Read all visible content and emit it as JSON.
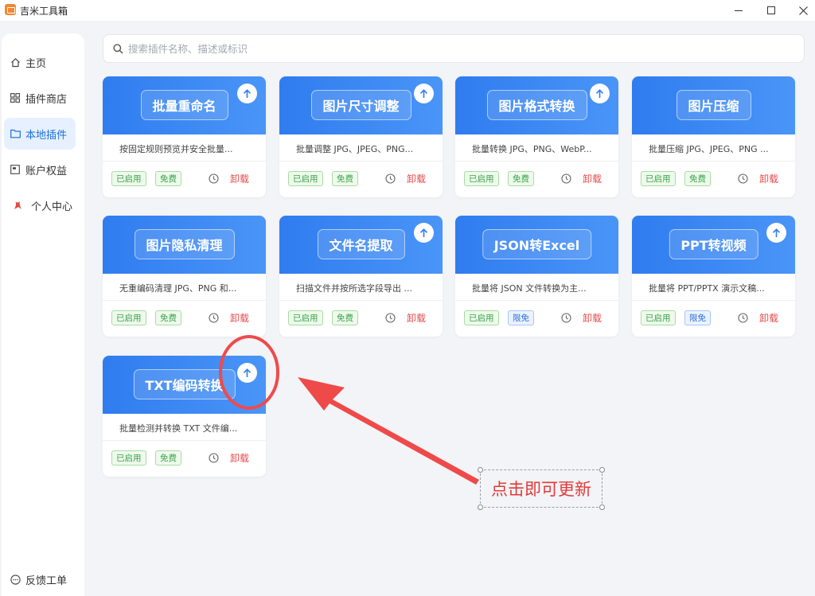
{
  "window": {
    "title": "吉米工具箱"
  },
  "sidebar": {
    "items": [
      {
        "label": "主页",
        "icon": "home-icon"
      },
      {
        "label": "插件商店",
        "icon": "grid-icon"
      },
      {
        "label": "本地插件",
        "icon": "folder-icon",
        "active": true
      },
      {
        "label": "账户权益",
        "icon": "account-icon"
      },
      {
        "label": "个人中心",
        "icon": "user-icon"
      }
    ],
    "feedback": {
      "label": "反馈工单",
      "icon": "chat-icon"
    }
  },
  "search": {
    "placeholder": "搜索插件名称、描述或标识",
    "value": ""
  },
  "cards": [
    {
      "title": "批量重命名",
      "desc": "按固定规则预览并安全批量...",
      "status": "已启用",
      "price": "免费",
      "action": "卸载",
      "update": true
    },
    {
      "title": "图片尺寸调整",
      "desc": "批量调整 JPG、JPEG、PNG...",
      "status": "已启用",
      "price": "免费",
      "action": "卸载",
      "update": true
    },
    {
      "title": "图片格式转换",
      "desc": "批量转换 JPG、PNG、WebP...",
      "status": "已启用",
      "price": "免费",
      "action": "卸载",
      "update": true
    },
    {
      "title": "图片压缩",
      "desc": "批量压缩 JPG、JPEG、PNG ...",
      "status": "已启用",
      "price": "免费",
      "action": "卸载",
      "update": false
    },
    {
      "title": "图片隐私清理",
      "desc": "无重编码清理 JPG、PNG 和...",
      "status": "已启用",
      "price": "免费",
      "action": "卸载",
      "update": false
    },
    {
      "title": "文件名提取",
      "desc": "扫描文件并按所选字段导出 ...",
      "status": "已启用",
      "price": "免费",
      "action": "卸载",
      "update": true
    },
    {
      "title": "JSON转Excel",
      "desc": "批量将 JSON 文件转换为主...",
      "status": "已启用",
      "price": "限免",
      "action": "卸载",
      "update": false
    },
    {
      "title": "PPT转视频",
      "desc": "批量将 PPT/PPTX 演示文稿...",
      "status": "已启用",
      "price": "限免",
      "action": "卸载",
      "update": true
    },
    {
      "title": "TXT编码转换",
      "desc": "批量检测并转换 TXT 文件编...",
      "status": "已启用",
      "price": "免费",
      "action": "卸载",
      "update": true
    }
  ],
  "annotation": {
    "text": "点击即可更新"
  },
  "colors": {
    "accent": "#2f7cf0",
    "danger": "#e84a4a",
    "success": "#3aa34a",
    "annotation": "#ef4a4a"
  }
}
